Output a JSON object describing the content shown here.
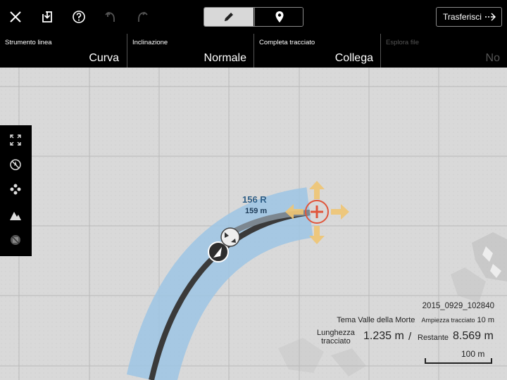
{
  "toolbar": {
    "close_icon": "close-icon",
    "save_icon": "save-icon",
    "help_icon": "help-icon",
    "undo_icon": "undo-icon",
    "redo_icon": "redo-icon",
    "mode_edit_icon": "pencil-icon",
    "mode_pin_icon": "location-pin-icon",
    "transfer_label": "Trasferisci"
  },
  "options": [
    {
      "label": "Strumento linea",
      "value": "Curva",
      "enabled": true
    },
    {
      "label": "Inclinazione",
      "value": "Normale",
      "enabled": true
    },
    {
      "label": "Completa tracciato",
      "value": "Collega",
      "enabled": true
    },
    {
      "label": "Esplora file",
      "value": "No",
      "enabled": false
    }
  ],
  "side_tools": [
    "expand-icon",
    "no-compass-icon",
    "waypoints-icon",
    "terrain-icon",
    "layers-off-icon"
  ],
  "curve": {
    "radius_label": "156 R",
    "length_label": "159 m"
  },
  "info": {
    "file_name": "2015_0929_102840",
    "theme": "Tema Valle della Morte",
    "width_label": "Ampiezza tracciato",
    "width_value": "10 m",
    "length_label_1": "Lunghezza",
    "length_label_2": "tracciato",
    "length_value": "1.235 m",
    "separator": "/",
    "remaining_label": "Restante",
    "remaining_value": "8.569 m",
    "scale_label": "100 m"
  },
  "colors": {
    "track_band": "#9cc4e4",
    "track_line": "#3a3a3a",
    "arrow": "#f0c674",
    "cursor": "#e0553a",
    "map_bg": "#d9d9d9"
  }
}
